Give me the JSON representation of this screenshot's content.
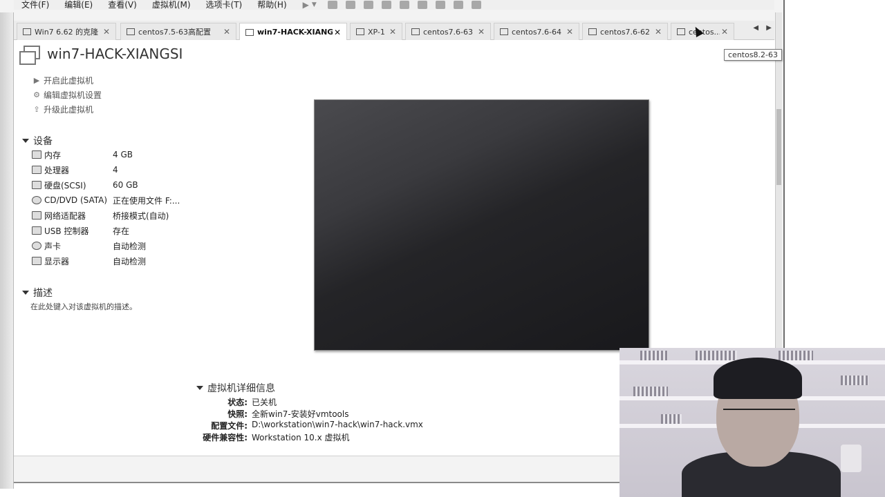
{
  "menubar": {
    "items": [
      "文件(F)",
      "编辑(E)",
      "查看(V)",
      "虚拟机(M)",
      "选项卡(T)",
      "帮助(H)"
    ]
  },
  "tabs": [
    {
      "label": "Win7 6.62 的克隆",
      "active": false
    },
    {
      "label": "centos7.5-63高配置",
      "active": false
    },
    {
      "label": "win7-HACK-XIANGSI",
      "active": true
    },
    {
      "label": "XP-1",
      "active": false
    },
    {
      "label": "centos7.6-63",
      "active": false
    },
    {
      "label": "centos7.6-64",
      "active": false
    },
    {
      "label": "centos7.6-62",
      "active": false
    },
    {
      "label": "centos...",
      "active": false
    }
  ],
  "tooltip": "centos8.2-63",
  "vm": {
    "title": "win7-HACK-XIANGSI",
    "actions": [
      "开启此虚拟机",
      "编辑虚拟机设置",
      "升级此虚拟机"
    ]
  },
  "devices": {
    "heading": "设备",
    "rows": [
      {
        "name": "内存",
        "value": "4 GB",
        "icon": "memory-icon"
      },
      {
        "name": "处理器",
        "value": "4",
        "icon": "cpu-icon"
      },
      {
        "name": "硬盘(SCSI)",
        "value": "60 GB",
        "icon": "disk-icon"
      },
      {
        "name": "CD/DVD (SATA)",
        "value": "正在使用文件 F:...",
        "icon": "cd-icon"
      },
      {
        "name": "网络适配器",
        "value": "桥接模式(自动)",
        "icon": "network-icon"
      },
      {
        "name": "USB 控制器",
        "value": "存在",
        "icon": "usb-icon"
      },
      {
        "name": "声卡",
        "value": "自动检测",
        "icon": "sound-icon"
      },
      {
        "name": "显示器",
        "value": "自动检测",
        "icon": "monitor-icon"
      }
    ]
  },
  "description": {
    "heading": "描述",
    "placeholder": "在此处键入对该虚拟机的描述。"
  },
  "details": {
    "heading": "虚拟机详细信息",
    "rows": [
      {
        "key": "状态:",
        "value": "已关机"
      },
      {
        "key": "快照:",
        "value": "全新win7-安装好vmtools"
      },
      {
        "key": "配置文件:",
        "value": "D:\\workstation\\win7-hack\\win7-hack.vmx"
      },
      {
        "key": "硬件兼容性:",
        "value": "Workstation 10.x 虚拟机"
      }
    ]
  }
}
